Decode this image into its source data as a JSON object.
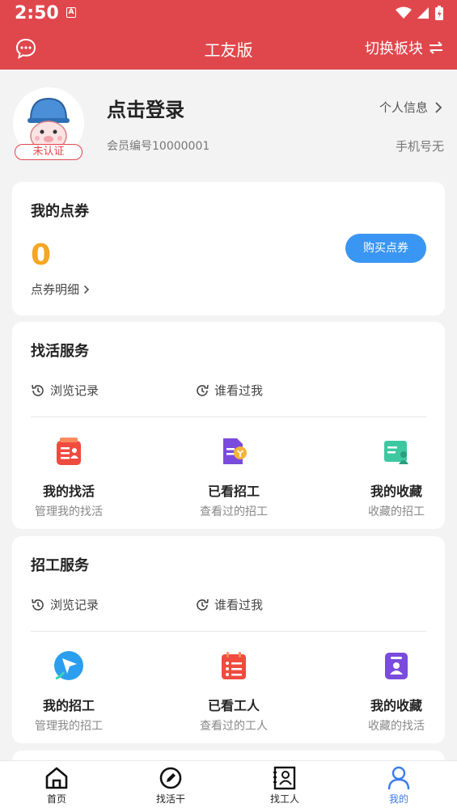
{
  "status": {
    "time": "2:50",
    "notif_icon": "A"
  },
  "appbar": {
    "title": "工友版",
    "switch_label": "切换板块"
  },
  "profile": {
    "login_text": "点击登录",
    "badge": "未认证",
    "member_id": "会员编号10000001",
    "personal_info": "个人信息",
    "phone": "手机号无"
  },
  "coupon": {
    "title": "我的点券",
    "count": "0",
    "detail": "点券明细",
    "buy": "购买点券"
  },
  "job_service": {
    "title": "找活服务",
    "history": "浏览记录",
    "visitors": "谁看过我",
    "items": [
      {
        "name": "我的找活",
        "sub": "管理我的找活"
      },
      {
        "name": "已看招工",
        "sub": "查看过的招工"
      },
      {
        "name": "我的收藏",
        "sub": "收藏的招工"
      }
    ]
  },
  "hire_service": {
    "title": "招工服务",
    "history": "浏览记录",
    "visitors": "谁看过我",
    "items": [
      {
        "name": "我的招工",
        "sub": "管理我的招工"
      },
      {
        "name": "已看工人",
        "sub": "查看过的工人"
      },
      {
        "name": "我的收藏",
        "sub": "收藏的找活"
      }
    ]
  },
  "tabs": [
    {
      "label": "首页"
    },
    {
      "label": "找活干"
    },
    {
      "label": "找工人"
    },
    {
      "label": "我的"
    }
  ],
  "colors": {
    "brand": "#e0474c",
    "accent_blue": "#3a96f3",
    "coin": "#f5a623",
    "tab_active": "#3a7bf0"
  }
}
